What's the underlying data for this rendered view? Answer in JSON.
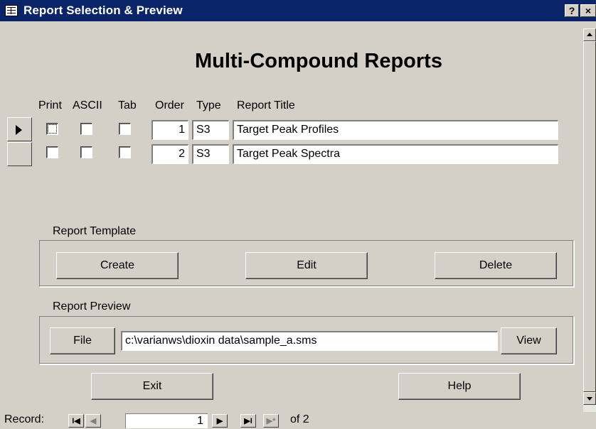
{
  "window": {
    "title": "Report Selection & Preview",
    "help_label": "?",
    "close_label": "×"
  },
  "heading": "Multi-Compound Reports",
  "columns": {
    "print": "Print",
    "ascii": "ASCII",
    "tab": "Tab",
    "order": "Order",
    "type": "Type",
    "title": "Report Title"
  },
  "rows": [
    {
      "print": false,
      "ascii": false,
      "tab": false,
      "order": "1",
      "type": "S3",
      "title": "Target Peak Profiles",
      "current": true
    },
    {
      "print": false,
      "ascii": false,
      "tab": false,
      "order": "2",
      "type": "S3",
      "title": "Target Peak Spectra",
      "current": false
    }
  ],
  "template_group": {
    "label": "Report Template",
    "create": "Create",
    "edit": "Edit",
    "delete": "Delete"
  },
  "preview_group": {
    "label": "Report Preview",
    "file_button": "File",
    "path": "c:\\varianws\\dioxin data\\sample_a.sms",
    "view_button": "View"
  },
  "footer": {
    "exit": "Exit",
    "help": "Help"
  },
  "record_nav": {
    "label": "Record:",
    "first": "I◀",
    "prev": "◀",
    "current": "1",
    "next": "▶",
    "last": "▶I",
    "new": "▶*",
    "of_text": "of",
    "total": "2"
  }
}
